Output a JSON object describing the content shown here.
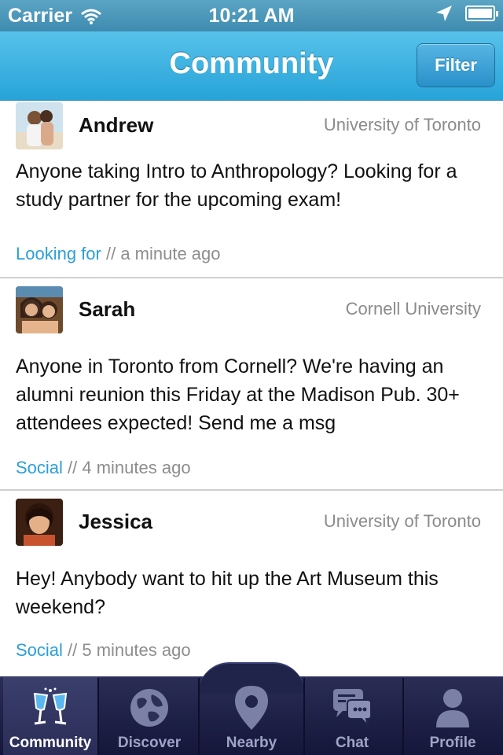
{
  "status_bar": {
    "carrier": "Carrier",
    "time": "10:21 AM"
  },
  "nav": {
    "title": "Community",
    "filter_label": "Filter"
  },
  "posts": [
    {
      "name": "Andrew",
      "school": "University of Toronto",
      "text": "Anyone taking Intro to Anthropology? Looking for a study partner for the upcoming exam!",
      "category": "Looking for",
      "separator": " // ",
      "time": "a minute ago"
    },
    {
      "name": "Sarah",
      "school": "Cornell University",
      "text": "Anyone in Toronto from Cornell? We're having an alumni reunion this Friday at the Madison Pub. 30+ attendees expected! Send me a msg",
      "category": "Social",
      "separator": " // ",
      "time": "4 minutes ago"
    },
    {
      "name": "Jessica",
      "school": "University of Toronto",
      "text": "Hey! Anybody want to hit up the Art Museum this weekend?",
      "category": "Social",
      "separator": " // ",
      "time": "5 minutes ago"
    }
  ],
  "tabs": [
    {
      "label": "Community",
      "icon": "champagne-glasses-icon"
    },
    {
      "label": "Discover",
      "icon": "globe-icon"
    },
    {
      "label": "Nearby",
      "icon": "map-pin-icon"
    },
    {
      "label": "Chat",
      "icon": "chat-bubbles-icon"
    },
    {
      "label": "Profile",
      "icon": "person-icon"
    }
  ],
  "colors": {
    "accent": "#2b9fd6",
    "nav": "#27a3d8",
    "tab_bar": "#14163a"
  }
}
